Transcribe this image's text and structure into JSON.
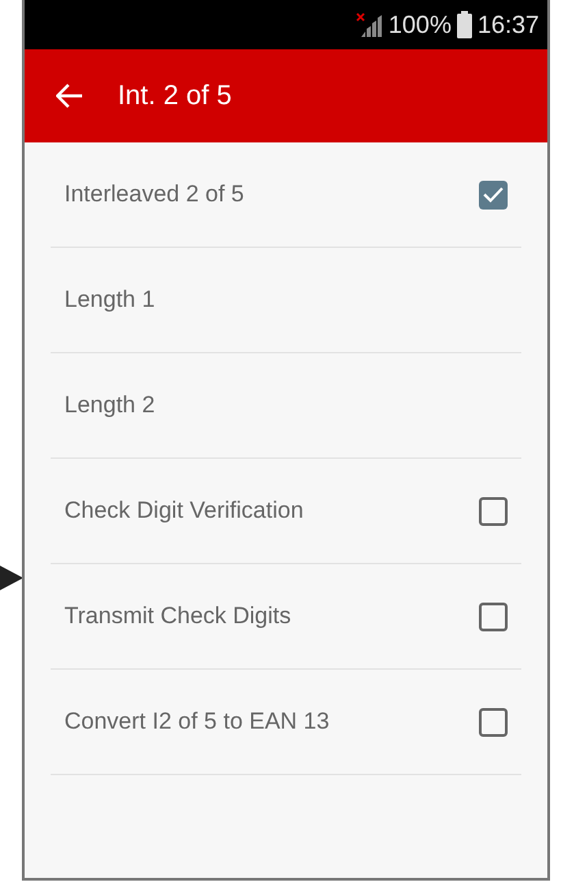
{
  "status_bar": {
    "no_signal": true,
    "battery": "100%",
    "time": "16:37"
  },
  "app_bar": {
    "title": "Int. 2 of 5"
  },
  "items": [
    {
      "kind": "checkbox",
      "label": "Interleaved 2 of 5",
      "checked": true
    },
    {
      "kind": "plain",
      "label": "Length 1"
    },
    {
      "kind": "plain",
      "label": "Length 2"
    },
    {
      "kind": "checkbox",
      "label": "Check Digit Verification",
      "checked": false
    },
    {
      "kind": "checkbox",
      "label": "Transmit Check Digits",
      "checked": false
    },
    {
      "kind": "checkbox",
      "label": "Convert I2 of 5 to EAN 13",
      "checked": false
    }
  ]
}
